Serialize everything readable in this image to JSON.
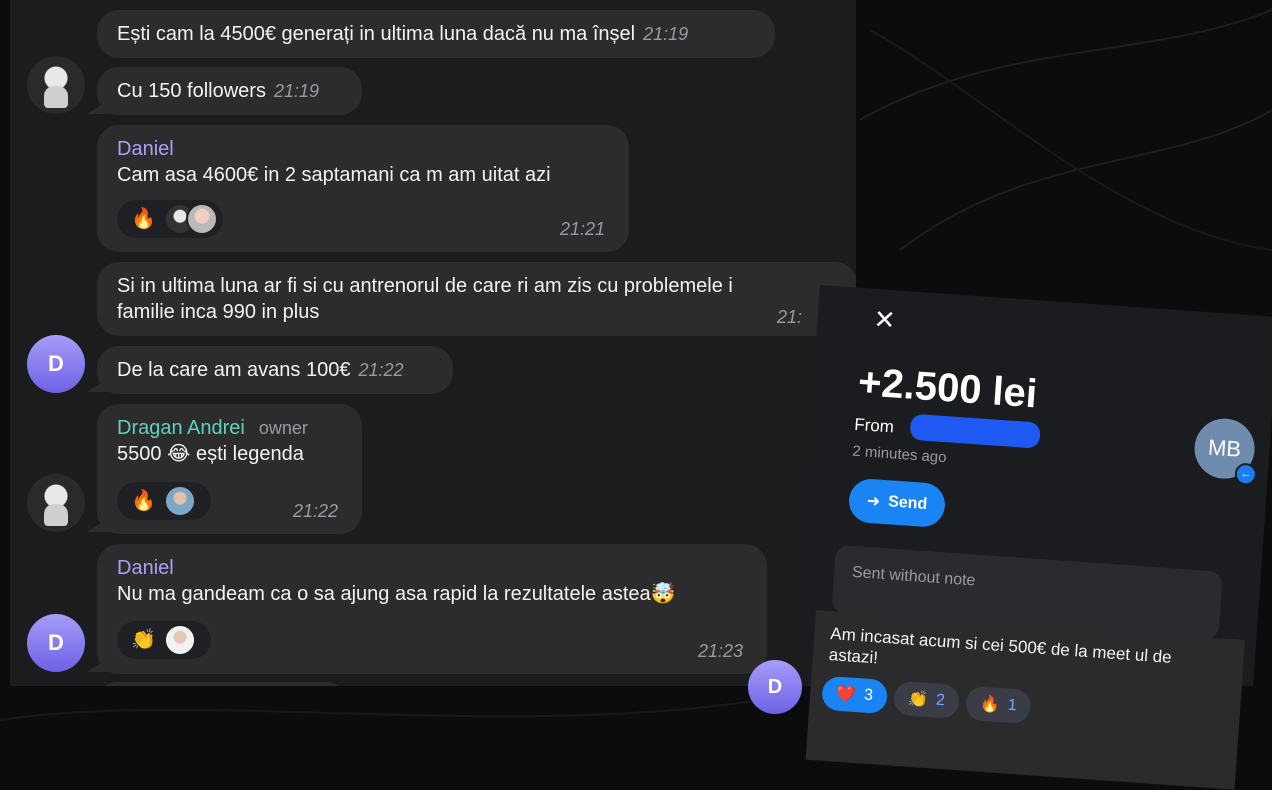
{
  "messages": [
    {
      "text": "Ești cam la 4500€ generați in ultima luna dacă nu ma înșel",
      "time": "21:19"
    },
    {
      "text": "Cu 150 followers",
      "time": "21:19"
    },
    {
      "sender": "Daniel",
      "text": "Cam asa 4600€ in 2 saptamani ca m am uitat azi",
      "time": "21:21",
      "reaction": "🔥"
    },
    {
      "line1": "Si in ultima luna ar fi si cu antrenorul de care ri am zis cu problemele i",
      "line2": "familie inca 990 in plus",
      "time": "21:"
    },
    {
      "text": "De la care am avans 100€",
      "time": "21:22"
    },
    {
      "sender": "Dragan Andrei",
      "role": "owner",
      "text": "5500 😂 ești legenda",
      "time": "21:22",
      "reaction": "🔥"
    },
    {
      "sender": "Daniel",
      "text": "Nu ma gandeam ca o sa ajung asa rapid la rezultatele astea🤯",
      "time": "21:23",
      "reaction": "👏"
    }
  ],
  "avatars": {
    "letter": "D"
  },
  "colors": {
    "daniel": "#b39cf4",
    "dragan": "#5fd3b8",
    "send": "#1a84f5"
  },
  "payment": {
    "close": "✕",
    "amount": "+2.500 lei",
    "from": "From",
    "ago": "2 minutes ago",
    "initials": "MB",
    "send_label": "Send",
    "note": "Sent without note"
  },
  "strip": {
    "text": "Am incasat acum si cei 500€ de la meet ul de astazi!",
    "r1_emoji": "❤️",
    "r1_count": "3",
    "r2_emoji": "👏",
    "r2_count": "2",
    "r3_emoji": "🔥",
    "r3_count": "1",
    "avatar": "D"
  }
}
